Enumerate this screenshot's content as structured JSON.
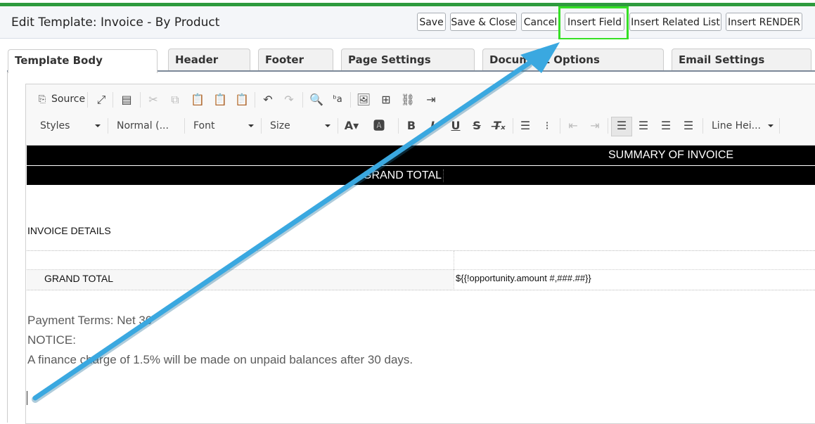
{
  "window": {
    "title": "Edit Template: Invoice - By Product"
  },
  "header_buttons": [
    {
      "label": "Save"
    },
    {
      "label": "Save & Close"
    },
    {
      "label": "Cancel"
    },
    {
      "label": "Insert Field"
    },
    {
      "label": "Insert Related List"
    },
    {
      "label": "Insert RENDER"
    }
  ],
  "tabs": [
    {
      "label": "Template Body"
    },
    {
      "label": "Header"
    },
    {
      "label": "Footer"
    },
    {
      "label": "Page Settings"
    },
    {
      "label": "Document Options"
    },
    {
      "label": "Email Settings"
    }
  ],
  "toolbar": {
    "source_label": "Source",
    "styles": "Styles",
    "format": "Normal (...",
    "font": "Font",
    "size": "Size",
    "line_height": "Line Hei..."
  },
  "document": {
    "summary_heading": "SUMMARY OF INVOICE",
    "grand_total_header": "GRAND TOTAL",
    "invoice_details": "INVOICE DETAILS",
    "grand_total_row_label": "GRAND TOTAL",
    "grand_total_row_value": "${{!opportunity.amount #,###.##}}",
    "payment_terms": "Payment Terms: Net 30",
    "notice": "NOTICE:",
    "finance_charge": "A finance charge of 1.5% will be made on unpaid balances after 30 days."
  },
  "colors": {
    "highlight": "#35e025",
    "arrow": "#3aa8e0",
    "topbar": "#2e9b3e"
  }
}
